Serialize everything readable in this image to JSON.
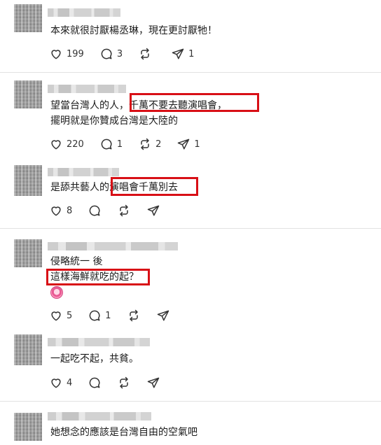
{
  "posts": [
    {
      "text_lines": [
        "本來就很討厭楊丞琳，現在更討厭牠！"
      ],
      "counts": {
        "like": "199",
        "reply": "3",
        "repost": "",
        "share": "1"
      }
    },
    {
      "text_lines": [
        "望當台灣人的人，千萬不要去聽演唱會，",
        "擺明就是你贊成台灣是大陸的"
      ],
      "counts": {
        "like": "220",
        "reply": "1",
        "repost": "2",
        "share": "1"
      }
    },
    {
      "text_lines": [
        "是舔共藝人的演唱會千萬別去"
      ],
      "counts": {
        "like": "8",
        "reply": "",
        "repost": "",
        "share": ""
      }
    },
    {
      "text_lines": [
        "侵略統一 後",
        "這樣海鮮就吃的起？"
      ],
      "emoji": "pig-face-emoji",
      "counts": {
        "like": "5",
        "reply": "1",
        "repost": "",
        "share": ""
      }
    },
    {
      "text_lines": [
        "一起吃不起，共貧。"
      ],
      "counts": {
        "like": "4",
        "reply": "",
        "repost": "",
        "share": ""
      }
    },
    {
      "text_lines": [
        "她想念的應該是台灣自由的空氣吧"
      ],
      "counts": {
        "like": "",
        "reply": "",
        "repost": "",
        "share": ""
      }
    }
  ],
  "colors": {
    "highlight": "#d80f16",
    "divider": "#e2e2e2",
    "icon": "#333333"
  }
}
